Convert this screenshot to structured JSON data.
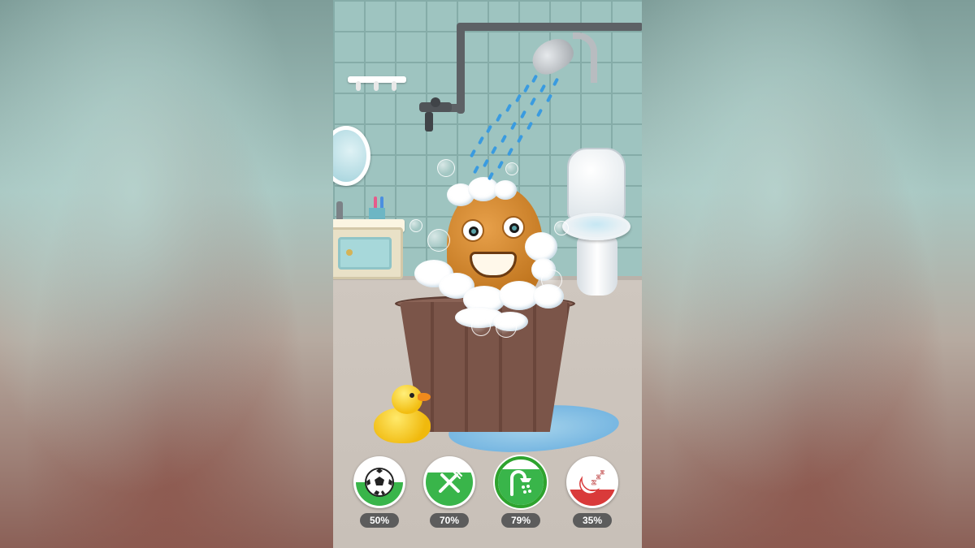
{
  "scene": {
    "name": "bathroom",
    "character_state": "bathing"
  },
  "stats": [
    {
      "key": "play",
      "icon": "soccer-ball-icon",
      "percent": "50%",
      "level": 0.5,
      "color": "#39b54a",
      "active": false
    },
    {
      "key": "food",
      "icon": "fork-knife-icon",
      "percent": "70%",
      "level": 0.7,
      "color": "#39b54a",
      "active": false
    },
    {
      "key": "hygiene",
      "icon": "shower-icon",
      "percent": "79%",
      "level": 0.79,
      "color": "#39b54a",
      "active": true
    },
    {
      "key": "sleep",
      "icon": "sleep-zzz-icon",
      "percent": "35%",
      "level": 0.35,
      "color": "#d93a3a",
      "active": false
    }
  ],
  "colors": {
    "wall_tile": "#9ec4c0",
    "floor": "#cfc7bf",
    "good_stat": "#39b54a",
    "low_stat": "#d93a3a",
    "active_ring": "#2ea32e",
    "badge": "#5c5c5c"
  }
}
